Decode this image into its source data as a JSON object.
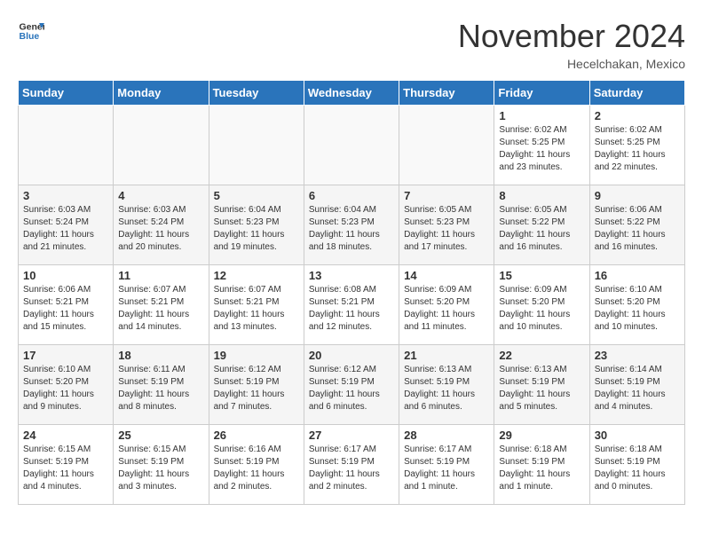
{
  "header": {
    "logo_line1": "General",
    "logo_line2": "Blue",
    "month": "November 2024",
    "location": "Hecelchakan, Mexico"
  },
  "weekdays": [
    "Sunday",
    "Monday",
    "Tuesday",
    "Wednesday",
    "Thursday",
    "Friday",
    "Saturday"
  ],
  "weeks": [
    [
      {
        "day": "",
        "info": ""
      },
      {
        "day": "",
        "info": ""
      },
      {
        "day": "",
        "info": ""
      },
      {
        "day": "",
        "info": ""
      },
      {
        "day": "",
        "info": ""
      },
      {
        "day": "1",
        "info": "Sunrise: 6:02 AM\nSunset: 5:25 PM\nDaylight: 11 hours\nand 23 minutes."
      },
      {
        "day": "2",
        "info": "Sunrise: 6:02 AM\nSunset: 5:25 PM\nDaylight: 11 hours\nand 22 minutes."
      }
    ],
    [
      {
        "day": "3",
        "info": "Sunrise: 6:03 AM\nSunset: 5:24 PM\nDaylight: 11 hours\nand 21 minutes."
      },
      {
        "day": "4",
        "info": "Sunrise: 6:03 AM\nSunset: 5:24 PM\nDaylight: 11 hours\nand 20 minutes."
      },
      {
        "day": "5",
        "info": "Sunrise: 6:04 AM\nSunset: 5:23 PM\nDaylight: 11 hours\nand 19 minutes."
      },
      {
        "day": "6",
        "info": "Sunrise: 6:04 AM\nSunset: 5:23 PM\nDaylight: 11 hours\nand 18 minutes."
      },
      {
        "day": "7",
        "info": "Sunrise: 6:05 AM\nSunset: 5:23 PM\nDaylight: 11 hours\nand 17 minutes."
      },
      {
        "day": "8",
        "info": "Sunrise: 6:05 AM\nSunset: 5:22 PM\nDaylight: 11 hours\nand 16 minutes."
      },
      {
        "day": "9",
        "info": "Sunrise: 6:06 AM\nSunset: 5:22 PM\nDaylight: 11 hours\nand 16 minutes."
      }
    ],
    [
      {
        "day": "10",
        "info": "Sunrise: 6:06 AM\nSunset: 5:21 PM\nDaylight: 11 hours\nand 15 minutes."
      },
      {
        "day": "11",
        "info": "Sunrise: 6:07 AM\nSunset: 5:21 PM\nDaylight: 11 hours\nand 14 minutes."
      },
      {
        "day": "12",
        "info": "Sunrise: 6:07 AM\nSunset: 5:21 PM\nDaylight: 11 hours\nand 13 minutes."
      },
      {
        "day": "13",
        "info": "Sunrise: 6:08 AM\nSunset: 5:21 PM\nDaylight: 11 hours\nand 12 minutes."
      },
      {
        "day": "14",
        "info": "Sunrise: 6:09 AM\nSunset: 5:20 PM\nDaylight: 11 hours\nand 11 minutes."
      },
      {
        "day": "15",
        "info": "Sunrise: 6:09 AM\nSunset: 5:20 PM\nDaylight: 11 hours\nand 10 minutes."
      },
      {
        "day": "16",
        "info": "Sunrise: 6:10 AM\nSunset: 5:20 PM\nDaylight: 11 hours\nand 10 minutes."
      }
    ],
    [
      {
        "day": "17",
        "info": "Sunrise: 6:10 AM\nSunset: 5:20 PM\nDaylight: 11 hours\nand 9 minutes."
      },
      {
        "day": "18",
        "info": "Sunrise: 6:11 AM\nSunset: 5:19 PM\nDaylight: 11 hours\nand 8 minutes."
      },
      {
        "day": "19",
        "info": "Sunrise: 6:12 AM\nSunset: 5:19 PM\nDaylight: 11 hours\nand 7 minutes."
      },
      {
        "day": "20",
        "info": "Sunrise: 6:12 AM\nSunset: 5:19 PM\nDaylight: 11 hours\nand 6 minutes."
      },
      {
        "day": "21",
        "info": "Sunrise: 6:13 AM\nSunset: 5:19 PM\nDaylight: 11 hours\nand 6 minutes."
      },
      {
        "day": "22",
        "info": "Sunrise: 6:13 AM\nSunset: 5:19 PM\nDaylight: 11 hours\nand 5 minutes."
      },
      {
        "day": "23",
        "info": "Sunrise: 6:14 AM\nSunset: 5:19 PM\nDaylight: 11 hours\nand 4 minutes."
      }
    ],
    [
      {
        "day": "24",
        "info": "Sunrise: 6:15 AM\nSunset: 5:19 PM\nDaylight: 11 hours\nand 4 minutes."
      },
      {
        "day": "25",
        "info": "Sunrise: 6:15 AM\nSunset: 5:19 PM\nDaylight: 11 hours\nand 3 minutes."
      },
      {
        "day": "26",
        "info": "Sunrise: 6:16 AM\nSunset: 5:19 PM\nDaylight: 11 hours\nand 2 minutes."
      },
      {
        "day": "27",
        "info": "Sunrise: 6:17 AM\nSunset: 5:19 PM\nDaylight: 11 hours\nand 2 minutes."
      },
      {
        "day": "28",
        "info": "Sunrise: 6:17 AM\nSunset: 5:19 PM\nDaylight: 11 hours\nand 1 minute."
      },
      {
        "day": "29",
        "info": "Sunrise: 6:18 AM\nSunset: 5:19 PM\nDaylight: 11 hours\nand 1 minute."
      },
      {
        "day": "30",
        "info": "Sunrise: 6:18 AM\nSunset: 5:19 PM\nDaylight: 11 hours\nand 0 minutes."
      }
    ]
  ]
}
